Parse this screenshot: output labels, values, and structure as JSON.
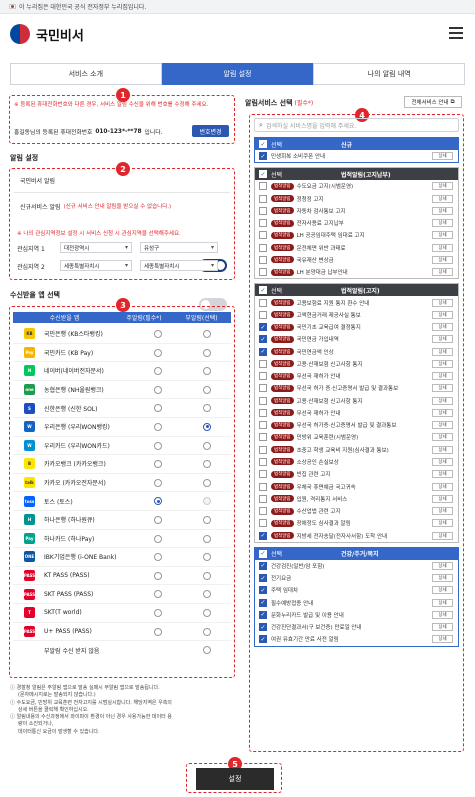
{
  "gov_banner": "이 누리집은 대한민국 공식 전자정부 누리집입니다.",
  "logo": "국민비서",
  "tabs": [
    "서비스 소개",
    "알림 설정",
    "나의 알림 내역"
  ],
  "badges": [
    "1",
    "2",
    "3",
    "4",
    "5"
  ],
  "phone": {
    "notice": "※ 등록된 휴대전화번호와 다른 경우, 서비스 알림 수신을 위해 번호를 수정해 주세요.",
    "text_prefix": "홍길동님의 등록된 휴대전화번호",
    "number": "010-123*-**78",
    "text_suffix": "입니다.",
    "change_button": "번호변경"
  },
  "alert_settings": {
    "title": "알림 설정",
    "bisi_label": "국민비서 알림",
    "new_label": "신규서비스 알림",
    "new_note": "(신규 서비스 안내 알림을 받으실 수 없습니다.)",
    "region_note": "※ 나의 관심지역정보 설정 시 서비스 신청 시 관심지역을 선택해주세요.",
    "region1_label": "관심지역 1",
    "region1_a": "대전광역시",
    "region1_b": "유성구",
    "region2_label": "관심지역 2",
    "region2_a": "세종특별자치시",
    "region2_b": "세종특별자치시"
  },
  "app_section": {
    "title": "수신받을 앱 선택",
    "col_app": "수신받을 앱",
    "col_main": "주알림(필수*)",
    "col_sub": "부알림(선택)",
    "apps": [
      {
        "name": "국민은행 (KB스타뱅킹)",
        "icon": "kb-star-icon",
        "color": "#f7c600",
        "label": "KB"
      },
      {
        "name": "국민카드 (KB Pay)",
        "icon": "kb-pay-icon",
        "color": "#f4b400",
        "label": "Pay"
      },
      {
        "name": "네이버(네이버전자문서)",
        "icon": "naver-icon",
        "color": "#03c75a",
        "label": "N"
      },
      {
        "name": "농협은행 (NH올원뱅크)",
        "icon": "nh-allone-icon",
        "color": "#1b9d4e",
        "label": "one"
      },
      {
        "name": "신한은행 (신한 SOL)",
        "icon": "shinhan-sol-icon",
        "color": "#1d4dbf",
        "label": "S"
      },
      {
        "name": "우리은행 (우리WON뱅킹)",
        "icon": "woori-won-icon",
        "color": "#1565c0",
        "label": "W"
      },
      {
        "name": "우리카드 (우리WON카드)",
        "icon": "woori-card-icon",
        "color": "#0091d5",
        "label": "W"
      },
      {
        "name": "카카오뱅크 (카카오뱅크)",
        "icon": "kakaobank-icon",
        "color": "#fee500",
        "label": "B"
      },
      {
        "name": "카카오 (카카오전자문서)",
        "icon": "kakao-icon",
        "color": "#fee500",
        "label": "talk"
      },
      {
        "name": "토스 (토스)",
        "icon": "toss-icon",
        "color": "#0064ff",
        "label": "toss"
      },
      {
        "name": "하나은행 (하나원큐)",
        "icon": "hana-one-q-icon",
        "color": "#009490",
        "label": "H"
      },
      {
        "name": "하나카드 (하나Pay)",
        "icon": "hana-pay-icon",
        "color": "#00a28e",
        "label": "Pay"
      },
      {
        "name": "IBK기업은행 (i-ONE Bank)",
        "icon": "ibk-ione-icon",
        "color": "#0b57a4",
        "label": "ONE"
      },
      {
        "name": "KT PASS (PASS)",
        "icon": "kt-pass-icon",
        "color": "#e4002b",
        "label": "PASS"
      },
      {
        "name": "SKT PASS (PASS)",
        "icon": "skt-pass-icon",
        "color": "#e4002b",
        "label": "PASS"
      },
      {
        "name": "SKT(T world)",
        "icon": "t-world-icon",
        "color": "#e4002b",
        "label": "T"
      },
      {
        "name": "U+ PASS (PASS)",
        "icon": "uplus-pass-icon",
        "color": "#e4002b",
        "label": "PASS"
      },
      {
        "name": "부알림 수신 받지 않음",
        "icon": "",
        "color": "",
        "label": ""
      }
    ],
    "main_selected_index": 9,
    "sub_selected_index": 5,
    "notes": [
      "경찰청 알림은 주알림 앱으로 발송 실패시 부알림 앱으로 발송됩니다.",
      "(문자메시지로는 발송되지 않습니다.)",
      "수도요금, 민방위 교육훈련 전자고지를 시범실시합니다. 해당지역은 우측의",
      "상세 버튼을 클릭해 확인하십시오.",
      "알림내용의 수신과정에서 와이파이 환경이 아닌 경우 사용가능한 데이터 용",
      "량이 소진되거나,",
      "데이터통신 요금이 발생할 수 있습니다."
    ]
  },
  "service_section": {
    "title": "알림서비스 선택",
    "required": "(필수*)",
    "guide_button": "전체서비스 안내",
    "search_placeholder": "검색하실 서비스명을 입력해 주세요.",
    "group1": {
      "select": "선택",
      "name": "신규",
      "items": [
        {
          "label": "민생회복 소비쿠폰 안내",
          "checked": true
        }
      ]
    },
    "group2": {
      "select": "선택",
      "name": "법적알림(고지납부)",
      "tag": "법적알림",
      "items": [
        {
          "label": "수도요금 고지(시범운영)",
          "checked": false
        },
        {
          "label": "정청정 고지",
          "checked": false
        },
        {
          "label": "자동차 검사통보 고지",
          "checked": false
        },
        {
          "label": "전자사용료 고지납부",
          "checked": false
        },
        {
          "label": "LH 공공임대주택 임대료 고지",
          "checked": false
        },
        {
          "label": "운전체면 위반 과태료",
          "checked": false
        },
        {
          "label": "국유재산 변상금",
          "checked": false
        },
        {
          "label": "LH 분양대금 납부안내",
          "checked": false
        }
      ]
    },
    "group3": {
      "select": "선택",
      "name": "법적알림(고지)",
      "tag": "법적알림",
      "items": [
        {
          "label": "고용보험료 지원 통지 환수 안내",
          "checked": false
        },
        {
          "label": "고액현금거래 제공사실 통보",
          "checked": false
        },
        {
          "label": "국민기초 교육급여 결정통지",
          "checked": true
        },
        {
          "label": "국민연금 가입내역",
          "checked": true
        },
        {
          "label": "국민연금액 인상",
          "checked": true
        },
        {
          "label": "고용·산재보험 신고사항 통지",
          "checked": false
        },
        {
          "label": "무선국 재허가 안내",
          "checked": false
        },
        {
          "label": "무선국 허가 증·신고증명서 발급 및 결과통보",
          "checked": false
        },
        {
          "label": "고용·산재보험 신고사항 통지",
          "checked": false
        },
        {
          "label": "무선국 재허가 안내",
          "checked": false
        },
        {
          "label": "무선국 허가증·신고증명서 발급 및 결과통보",
          "checked": false
        },
        {
          "label": "민방위 교육훈련(시범운영)",
          "checked": false
        },
        {
          "label": "초중고 학생 교육비 지원(심사결과 통보)",
          "checked": false
        },
        {
          "label": "소상공인 손실보상",
          "checked": false
        },
        {
          "label": "빈집 관련 고지",
          "checked": false
        },
        {
          "label": "우체국 휴면예금 국고귀속",
          "checked": false
        },
        {
          "label": "입원, 격리통지 서비스",
          "checked": false
        },
        {
          "label": "수산업법 관련 고지",
          "checked": false
        },
        {
          "label": "장애정도 심사결과 알림",
          "checked": false
        },
        {
          "label": "지방세 전자송달(전자사서함) 도착 안내",
          "checked": true
        }
      ]
    },
    "group4": {
      "select": "선택",
      "name": "건강/주거/복지",
      "items": [
        {
          "label": "건강검진(일반/암 포함)",
          "checked": true
        },
        {
          "label": "전기요금",
          "checked": true
        },
        {
          "label": "주택 임대차",
          "checked": true
        },
        {
          "label": "필수예방접종 안내",
          "checked": true
        },
        {
          "label": "문화누리카드 발급 및 이용 안내",
          "checked": true
        },
        {
          "label": "건강진단결과서(구 보건증) 만료일 안내",
          "checked": true
        },
        {
          "label": "여권 유효기간 만료 사전 알림",
          "checked": true
        }
      ]
    },
    "detail_button": "상세"
  },
  "submit_button": "설정"
}
